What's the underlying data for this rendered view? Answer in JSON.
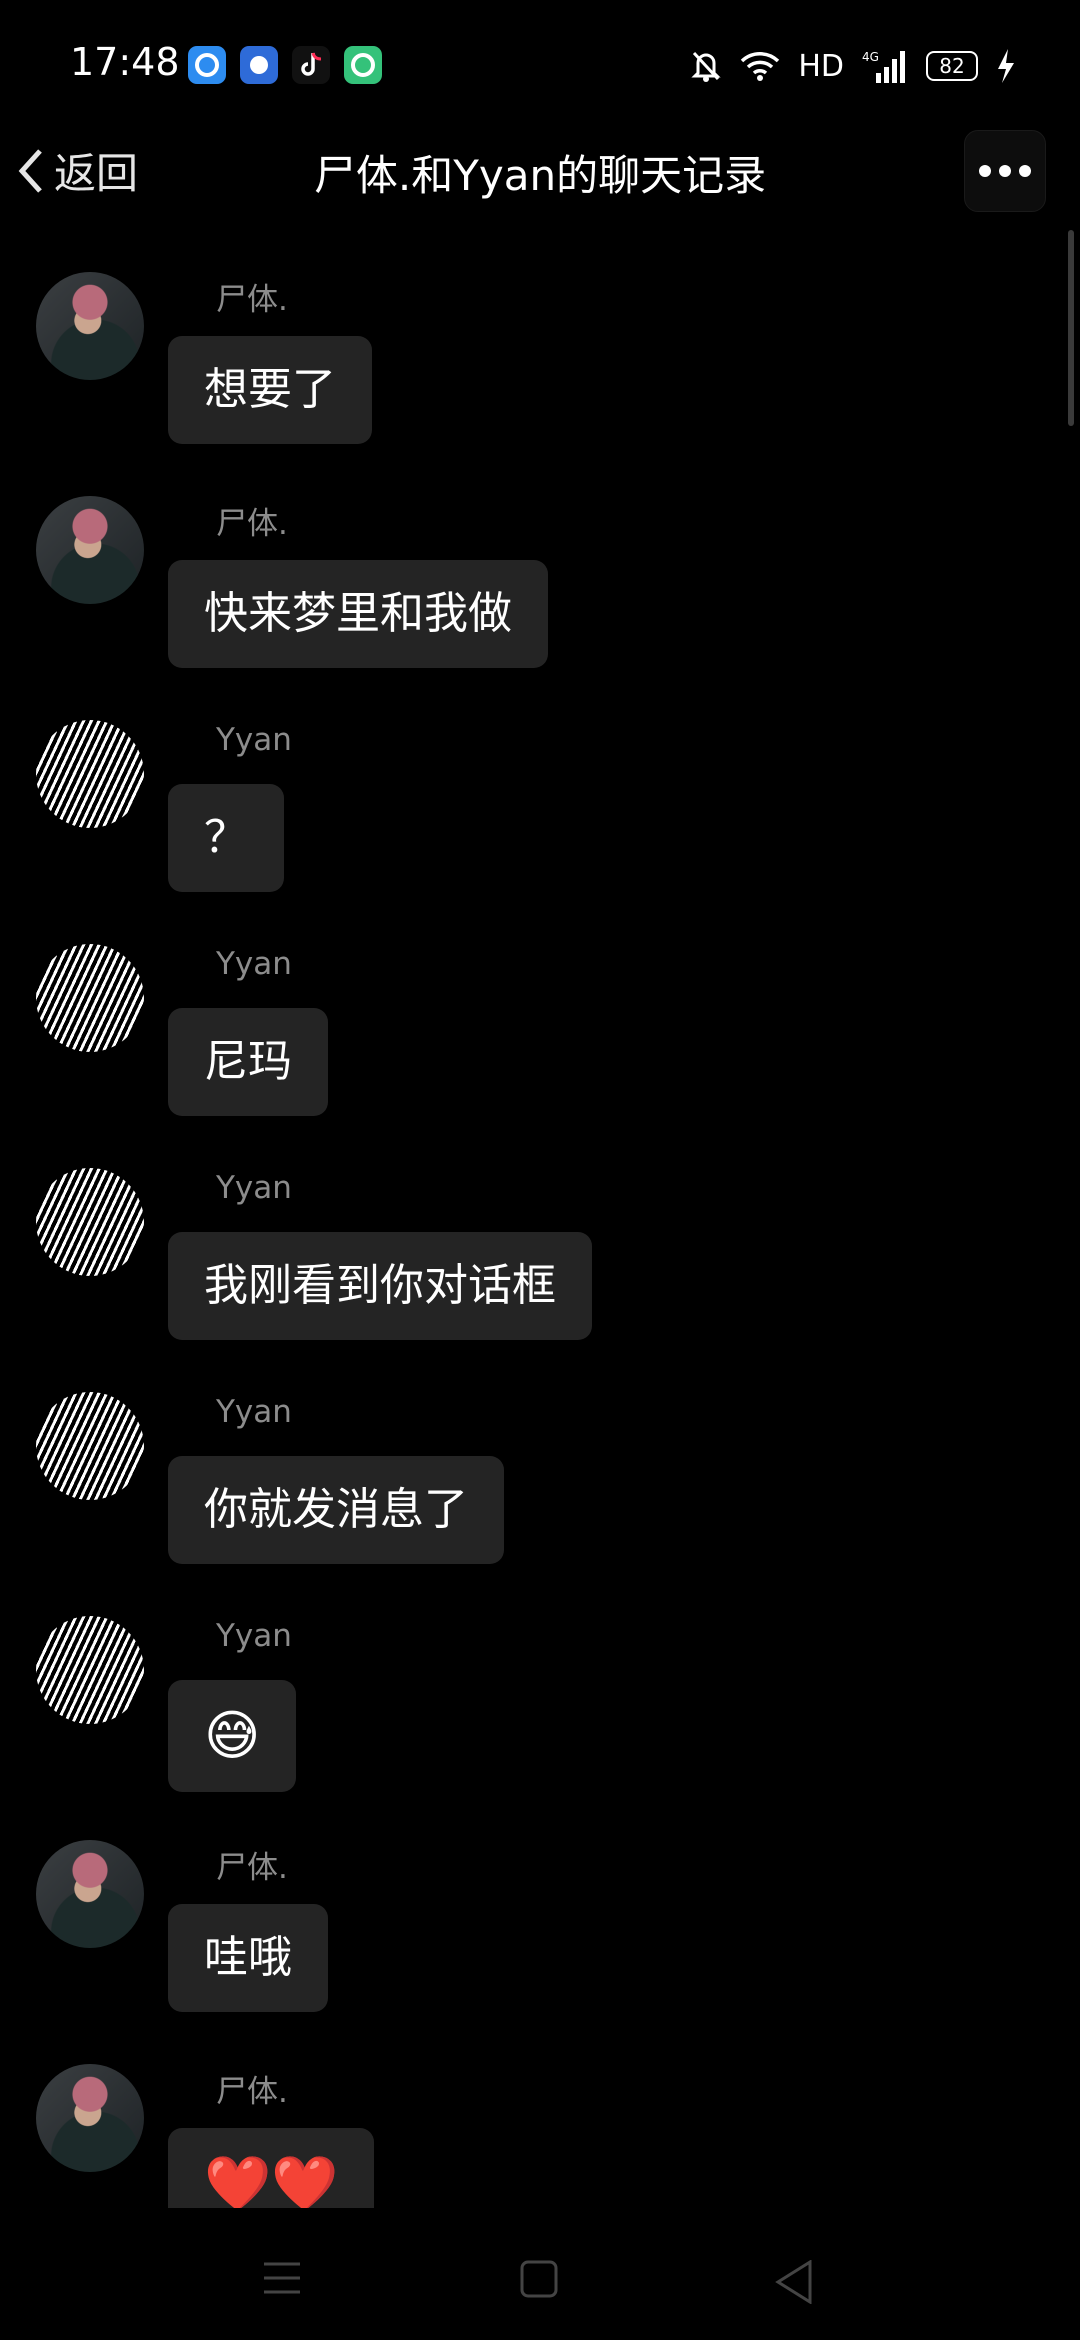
{
  "status_bar": {
    "time": "17:48",
    "network": "HD",
    "battery": "82"
  },
  "header": {
    "back_label": "返回",
    "title": "尸体.和Yyan的聊天记录"
  },
  "messages": [
    {
      "sender": "尸体.",
      "text": "想要了",
      "avatar": "a"
    },
    {
      "sender": "尸体.",
      "text": "快来梦里和我做",
      "avatar": "a"
    },
    {
      "sender": "Yyan",
      "text": "？",
      "avatar": "b"
    },
    {
      "sender": "Yyan",
      "text": "尼玛",
      "avatar": "b"
    },
    {
      "sender": "Yyan",
      "text": "我刚看到你对话框",
      "avatar": "b"
    },
    {
      "sender": "Yyan",
      "text": "你就发消息了",
      "avatar": "b"
    },
    {
      "sender": "Yyan",
      "text": "😅",
      "avatar": "b"
    },
    {
      "sender": "尸体.",
      "text": "哇哦",
      "avatar": "a"
    },
    {
      "sender": "尸体.",
      "text": "❤️❤️",
      "avatar": "a"
    }
  ],
  "icons": {
    "back": "chevron-left-icon",
    "more": "more-icon",
    "nav_menu": "menu-icon",
    "nav_home": "home-square-icon",
    "nav_back": "back-triangle-icon"
  }
}
